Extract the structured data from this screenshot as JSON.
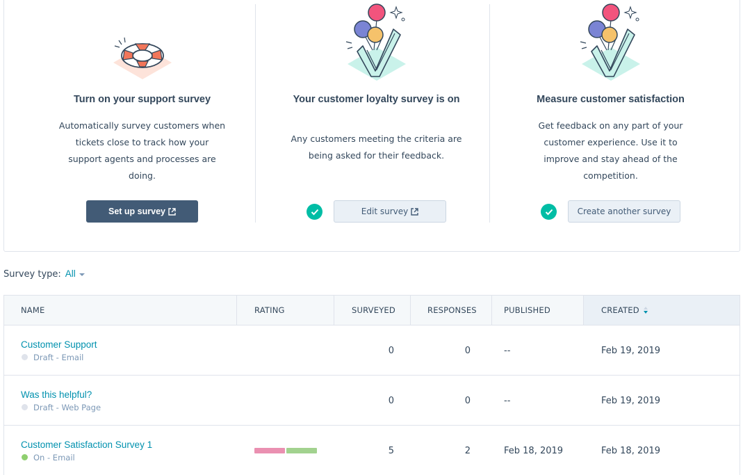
{
  "cards": [
    {
      "title": "Turn on your support survey",
      "description": "Automatically survey customers when tickets close to track how your support agents and processes are doing.",
      "button_label": "Set up survey",
      "illustration": "lifebuoy-illustration"
    },
    {
      "title": "Your customer loyalty survey is on",
      "description": "Any customers meeting the criteria are being asked for their feedback.",
      "button_label": "Edit survey",
      "illustration": "balloons-checkmark-illustration",
      "status_icon": "check-circle-icon"
    },
    {
      "title": "Measure customer satisfaction",
      "description": "Get feedback on any part of your customer experience. Use it to improve and stay ahead of the competition.",
      "button_label": "Create another survey",
      "illustration": "balloons-checkmark-illustration",
      "status_icon": "check-circle-icon"
    }
  ],
  "filter": {
    "label": "Survey type:",
    "value": "All"
  },
  "table": {
    "columns": [
      "NAME",
      "RATING",
      "SURVEYED",
      "RESPONSES",
      "PUBLISHED",
      "CREATED"
    ],
    "sorted_column": "CREATED",
    "rows": [
      {
        "name": "Customer Support",
        "status": "Draft - Email",
        "status_color": "#dfe3eb",
        "surveyed": "0",
        "responses": "0",
        "published": "--",
        "created": "Feb 19, 2019"
      },
      {
        "name": "Was this helpful?",
        "status": "Draft - Web Page",
        "status_color": "#dfe3eb",
        "surveyed": "0",
        "responses": "0",
        "published": "--",
        "created": "Feb 19, 2019"
      },
      {
        "name": "Customer Satisfaction Survey 1",
        "status": "On - Email",
        "status_color": "#8fcf6f",
        "rating_segments": [
          {
            "share": 0.5,
            "color": "#ea90b1"
          },
          {
            "share": 0.5,
            "color": "#a2d28f"
          }
        ],
        "surveyed": "5",
        "responses": "2",
        "published": "Feb 18, 2019",
        "created": "Feb 18, 2019"
      }
    ]
  },
  "colors": {
    "primary_button": "#425b76",
    "link": "#0091ae",
    "success": "#00bda5"
  }
}
